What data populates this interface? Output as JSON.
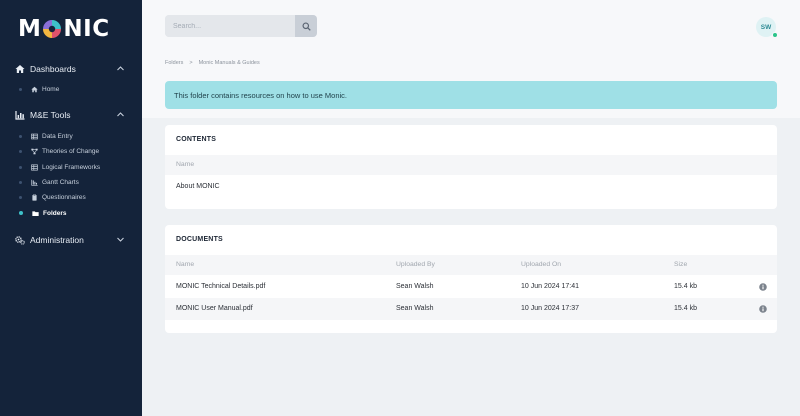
{
  "app": {
    "logo_text_left": "M",
    "logo_text_right": "NIC"
  },
  "colors": {
    "sidebar_bg": "#14233a",
    "accent": "#3ec1c9",
    "alert_bg": "#9fe0e6",
    "online": "#2bc48a"
  },
  "sidebar": {
    "dashboards": {
      "label": "Dashboards",
      "icon": "home-icon",
      "items": [
        {
          "label": "Home",
          "icon": "home-icon"
        }
      ]
    },
    "me_tools": {
      "label": "M&E Tools",
      "icon": "chart-icon",
      "items": [
        {
          "label": "Data Entry",
          "icon": "table-icon"
        },
        {
          "label": "Theories of Change",
          "icon": "network-icon"
        },
        {
          "label": "Logical Frameworks",
          "icon": "grid-icon"
        },
        {
          "label": "Gantt Charts",
          "icon": "gantt-icon"
        },
        {
          "label": "Questionnaires",
          "icon": "clipboard-icon"
        },
        {
          "label": "Folders",
          "icon": "folder-icon",
          "active": true
        }
      ]
    },
    "administration": {
      "label": "Administration",
      "icon": "cogs-icon"
    }
  },
  "header": {
    "search": {
      "placeholder": "Search...",
      "value": ""
    },
    "user_initials": "SW"
  },
  "breadcrumb": {
    "root": "Folders",
    "separator": ">",
    "current": "Monic Manuals & Guides"
  },
  "alert": {
    "text": "This folder contains resources on how to use Monic."
  },
  "contents": {
    "title": "CONTENTS",
    "columns": {
      "name": "Name"
    },
    "folders": [
      {
        "name": "About MONIC"
      }
    ]
  },
  "documents": {
    "title": "DOCUMENTS",
    "columns": {
      "name": "Name",
      "uploaded_by": "Uploaded By",
      "uploaded_on": "Uploaded On",
      "size": "Size"
    },
    "rows": [
      {
        "name": "MONIC Technical Details.pdf",
        "uploaded_by": "Sean Walsh",
        "uploaded_on": "10 Jun 2024 17:41",
        "size": "15.4 kb"
      },
      {
        "name": "MONIC User Manual.pdf",
        "uploaded_by": "Sean Walsh",
        "uploaded_on": "10 Jun 2024 17:37",
        "size": "15.4 kb"
      }
    ]
  }
}
